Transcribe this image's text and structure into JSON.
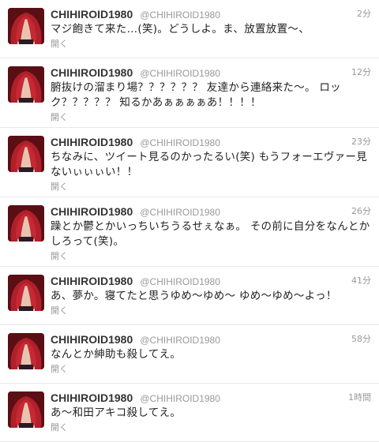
{
  "tweets": [
    {
      "name": "CHIHIROID1980",
      "handle": "@CHIHIROID1980",
      "time": "2分",
      "text": "マジ飽きて来た…(笑)。どうしよ。ま、放置放置〜、",
      "expand": "開く"
    },
    {
      "name": "CHIHIROID1980",
      "handle": "@CHIHIROID1980",
      "time": "12分",
      "text": "腑抜けの溜まり場？？？？？？ 友達から連絡来た〜。 ロック？？？？？ 知るかあぁぁぁぁあ！！！！",
      "expand": "開く"
    },
    {
      "name": "CHIHIROID1980",
      "handle": "@CHIHIROID1980",
      "time": "23分",
      "text": "ちなみに、ツイート見るのかったるい(笑) もうフォーエヴァー見ないぃぃぃい！！",
      "expand": "開く"
    },
    {
      "name": "CHIHIROID1980",
      "handle": "@CHIHIROID1980",
      "time": "26分",
      "text": "躁とか鬱とかいっちいちうるせぇなぁ。 その前に自分をなんとかしろって(笑)。",
      "expand": "開く"
    },
    {
      "name": "CHIHIROID1980",
      "handle": "@CHIHIROID1980",
      "time": "41分",
      "text": "あ、夢か。寝てたと思うゆめ〜ゆめ〜 ゆめ〜ゆめ〜よっ！",
      "expand": "開く"
    },
    {
      "name": "CHIHIROID1980",
      "handle": "@CHIHIROID1980",
      "time": "58分",
      "text": "なんとか紳助も殺してえ。",
      "expand": "開く"
    },
    {
      "name": "CHIHIROID1980",
      "handle": "@CHIHIROID1980",
      "time": "1時間",
      "text": "あ〜和田アキコ殺してえ。",
      "expand": "開く"
    }
  ],
  "avatar_icon": "profile-photo-avatar",
  "colors": {
    "name": "#333333",
    "meta": "#999999",
    "divider": "#e8e8e8",
    "avatar_bg": "#6a1418"
  }
}
